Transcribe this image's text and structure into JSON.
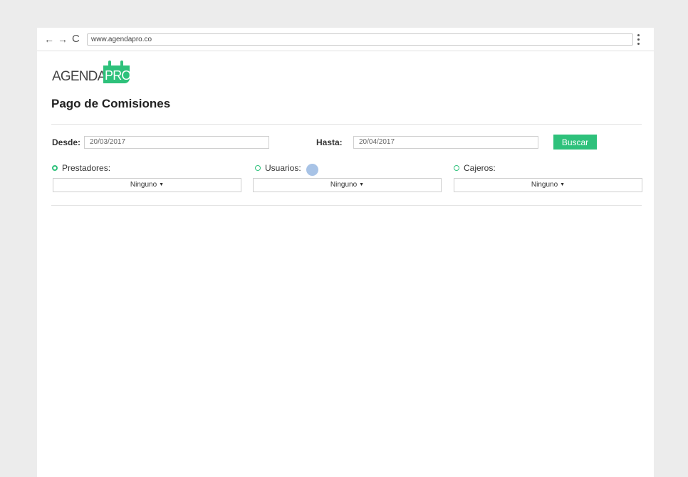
{
  "browser": {
    "url": "www.agendapro.co",
    "icons": {
      "back": "arrow-left-icon",
      "forward": "arrow-right-icon",
      "reload": "reload-icon",
      "menu": "kebab-menu-icon"
    }
  },
  "logo": {
    "text_main": "AGENDA",
    "text_accent": "PRO",
    "accent_color": "#2ec17b"
  },
  "page": {
    "title": "Pago de Comisiones"
  },
  "filters": {
    "desde_label": "Desde:",
    "desde_value": "20/03/2017",
    "hasta_label": "Hasta:",
    "hasta_value": "20/04/2017",
    "search_label": "Buscar"
  },
  "groups": [
    {
      "label": "Prestadores:",
      "checked": true,
      "dropdown": "Ninguno"
    },
    {
      "label": "Usuarios:",
      "checked": false,
      "dropdown": "Ninguno"
    },
    {
      "label": "Cajeros:",
      "checked": false,
      "dropdown": "Ninguno"
    }
  ]
}
